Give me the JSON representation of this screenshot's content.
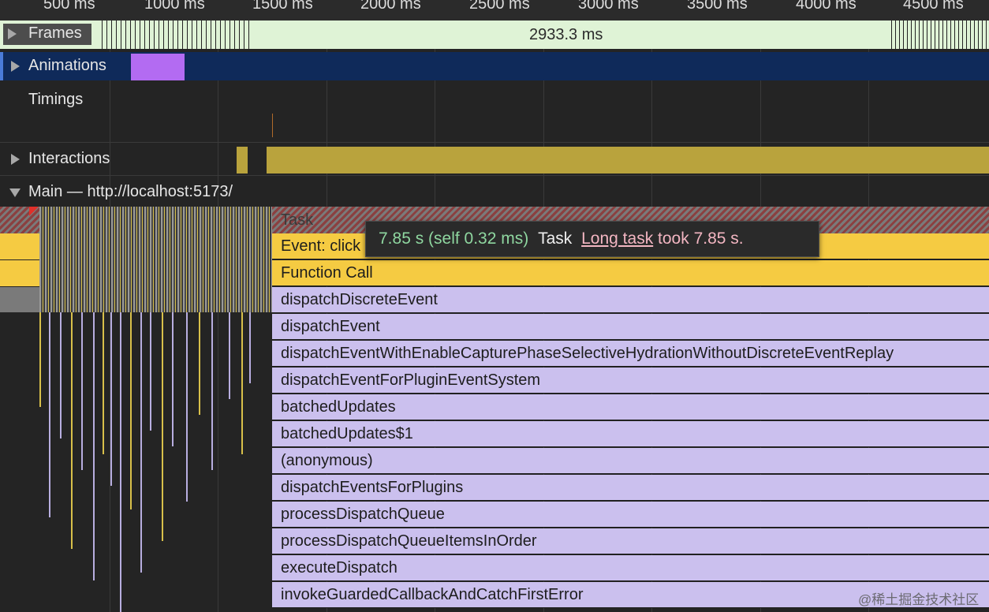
{
  "ruler": {
    "ticks": [
      "500 ms",
      "1000 ms",
      "1500 ms",
      "2000 ms",
      "2500 ms",
      "3000 ms",
      "3500 ms",
      "4000 ms",
      "4500 ms"
    ]
  },
  "tracks": {
    "frames": {
      "label": "Frames",
      "duration": "2933.3 ms"
    },
    "animations": {
      "label": "Animations"
    },
    "timings": {
      "label": "Timings"
    },
    "interactions": {
      "label": "Interactions"
    },
    "main": {
      "label": "Main — http://localhost:5173/"
    }
  },
  "flame": {
    "task": "Task",
    "rows": [
      "Event: click",
      "Function Call",
      "dispatchDiscreteEvent",
      "dispatchEvent",
      "dispatchEventWithEnableCapturePhaseSelectiveHydrationWithoutDiscreteEventReplay",
      "dispatchEventForPluginEventSystem",
      "batchedUpdates",
      "batchedUpdates$1",
      "(anonymous)",
      "dispatchEventsForPlugins",
      "processDispatchQueue",
      "processDispatchQueueItemsInOrder",
      "executeDispatch",
      "invokeGuardedCallbackAndCatchFirstError"
    ]
  },
  "tooltip": {
    "duration": "7.85 s (self 0.32 ms)",
    "name": "Task",
    "link": "Long task",
    "message": "took 7.85 s."
  },
  "watermark": "@稀土掘金技术社区",
  "colors": {
    "frames_bar": "#dff3d6",
    "animations_bg": "#0f2a5a",
    "animation_block": "#b36bf2",
    "interaction_bar": "#b9a33d",
    "flame_yellow": "#f5cb42",
    "flame_lavender": "#cbc0ee",
    "tooltip_green": "#8fd7a0",
    "tooltip_pink": "#f3b6c2"
  }
}
